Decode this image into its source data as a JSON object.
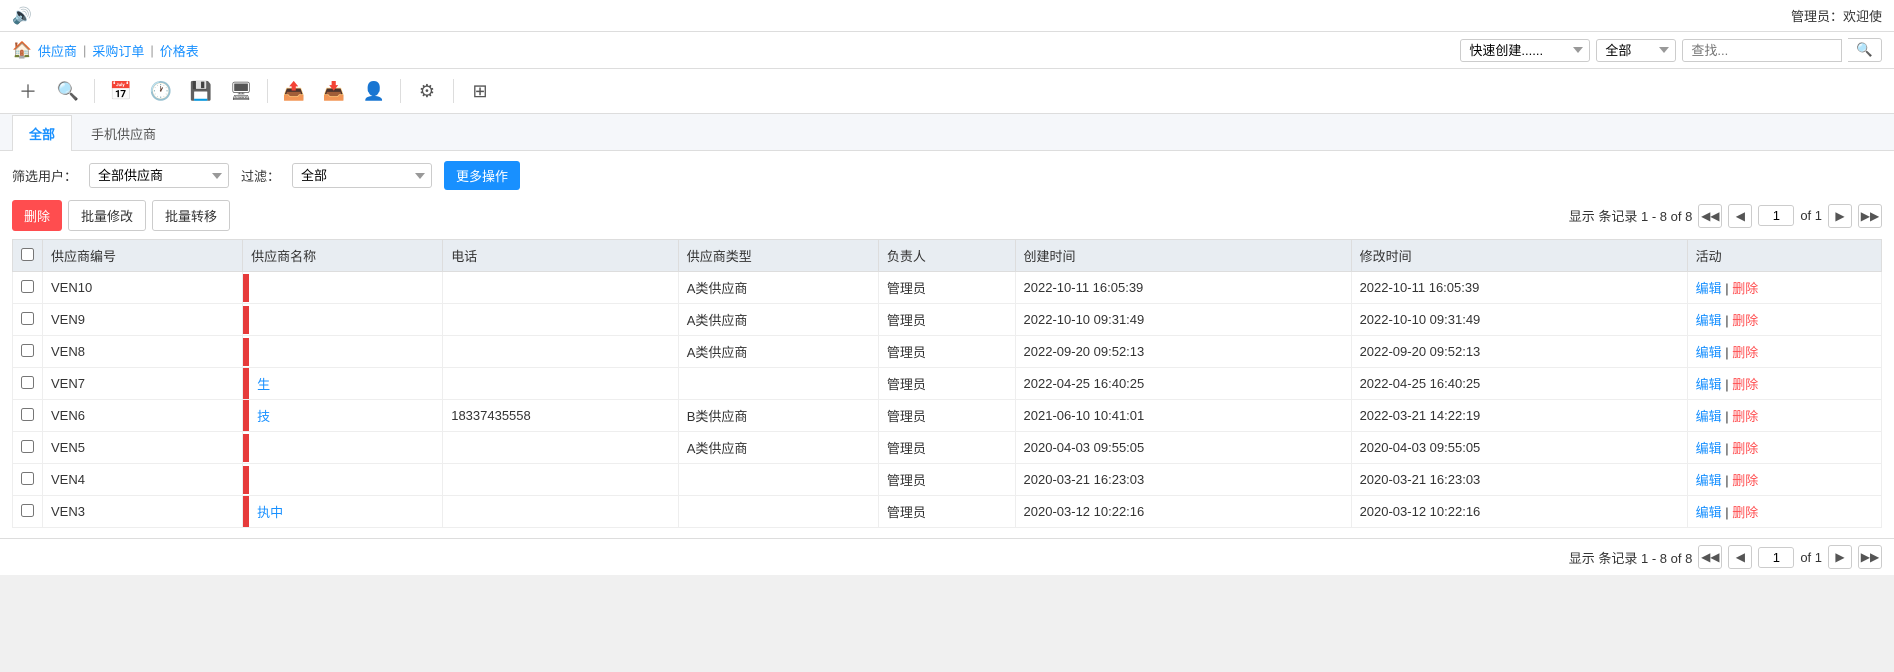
{
  "topbar": {
    "speaker_icon": "🔊",
    "admin_text": "管理员：欢迎使"
  },
  "navbar": {
    "home_icon": "🏠",
    "links": [
      "供应商",
      "采购订单",
      "价格表"
    ],
    "quick_create_placeholder": "快速创建......",
    "filter_options": [
      "全部"
    ],
    "search_placeholder": "查找..."
  },
  "toolbar": {
    "icons": [
      {
        "name": "add-icon",
        "symbol": "＋"
      },
      {
        "name": "search-icon",
        "symbol": "🔍"
      },
      {
        "name": "calendar-icon",
        "symbol": "📅"
      },
      {
        "name": "clock-icon",
        "symbol": "🕐"
      },
      {
        "name": "save-icon",
        "symbol": "💾"
      },
      {
        "name": "monitor-icon",
        "symbol": "🖥"
      },
      {
        "name": "upload-icon",
        "symbol": "📤"
      },
      {
        "name": "download-icon",
        "symbol": "📥"
      },
      {
        "name": "user-icon",
        "symbol": "👤"
      },
      {
        "name": "settings-icon",
        "symbol": "⚙"
      },
      {
        "name": "grid-icon",
        "symbol": "⊞"
      }
    ]
  },
  "tabs": [
    {
      "label": "全部",
      "active": true
    },
    {
      "label": "手机供应商",
      "active": false
    }
  ],
  "filter": {
    "user_label": "筛选用户：",
    "user_options": [
      "全部供应商"
    ],
    "filter_label": "过滤：",
    "filter_options": [
      "全部"
    ],
    "more_btn": "更多操作"
  },
  "actions": {
    "delete_btn": "删除",
    "batch_edit_btn": "批量修改",
    "batch_transfer_btn": "批量转移"
  },
  "pagination": {
    "display_text": "显示 条记录 1 - 8 of 8",
    "current_page": "1",
    "total_pages": "of 1"
  },
  "table": {
    "headers": [
      "",
      "供应商编号",
      "供应商名称",
      "电话",
      "供应商类型",
      "负责人",
      "创建时间",
      "修改时间",
      "活动"
    ],
    "rows": [
      {
        "id": "VEN10",
        "name": "",
        "name_has_bar": true,
        "phone": "",
        "type": "A类供应商",
        "owner": "管理员",
        "created": "2022-10-11 16:05:39",
        "modified": "2022-10-11 16:05:39"
      },
      {
        "id": "VEN9",
        "name": "",
        "name_has_bar": true,
        "phone": "",
        "type": "A类供应商",
        "owner": "管理员",
        "created": "2022-10-10 09:31:49",
        "modified": "2022-10-10 09:31:49"
      },
      {
        "id": "VEN8",
        "name": "",
        "name_has_bar": true,
        "phone": "",
        "type": "A类供应商",
        "owner": "管理员",
        "created": "2022-09-20 09:52:13",
        "modified": "2022-09-20 09:52:13"
      },
      {
        "id": "VEN7",
        "name": "生",
        "name_has_bar": true,
        "phone": "",
        "type": "",
        "owner": "管理员",
        "created": "2022-04-25 16:40:25",
        "modified": "2022-04-25 16:40:25"
      },
      {
        "id": "VEN6",
        "name": "技",
        "name_has_bar": true,
        "phone": "18337435558",
        "type": "B类供应商",
        "owner": "管理员",
        "created": "2021-06-10 10:41:01",
        "modified": "2022-03-21 14:22:19"
      },
      {
        "id": "VEN5",
        "name": "",
        "name_has_bar": true,
        "phone": "",
        "type": "A类供应商",
        "owner": "管理员",
        "created": "2020-04-03 09:55:05",
        "modified": "2020-04-03 09:55:05"
      },
      {
        "id": "VEN4",
        "name": "",
        "name_has_bar": true,
        "phone": "",
        "type": "",
        "owner": "管理员",
        "created": "2020-03-21 16:23:03",
        "modified": "2020-03-21 16:23:03"
      },
      {
        "id": "VEN3",
        "name": "执中",
        "name_has_bar": true,
        "phone": "",
        "type": "",
        "owner": "管理员",
        "created": "2020-03-12 10:22:16",
        "modified": "2020-03-12 10:22:16"
      }
    ],
    "edit_label": "编辑",
    "delete_label": "删除"
  }
}
